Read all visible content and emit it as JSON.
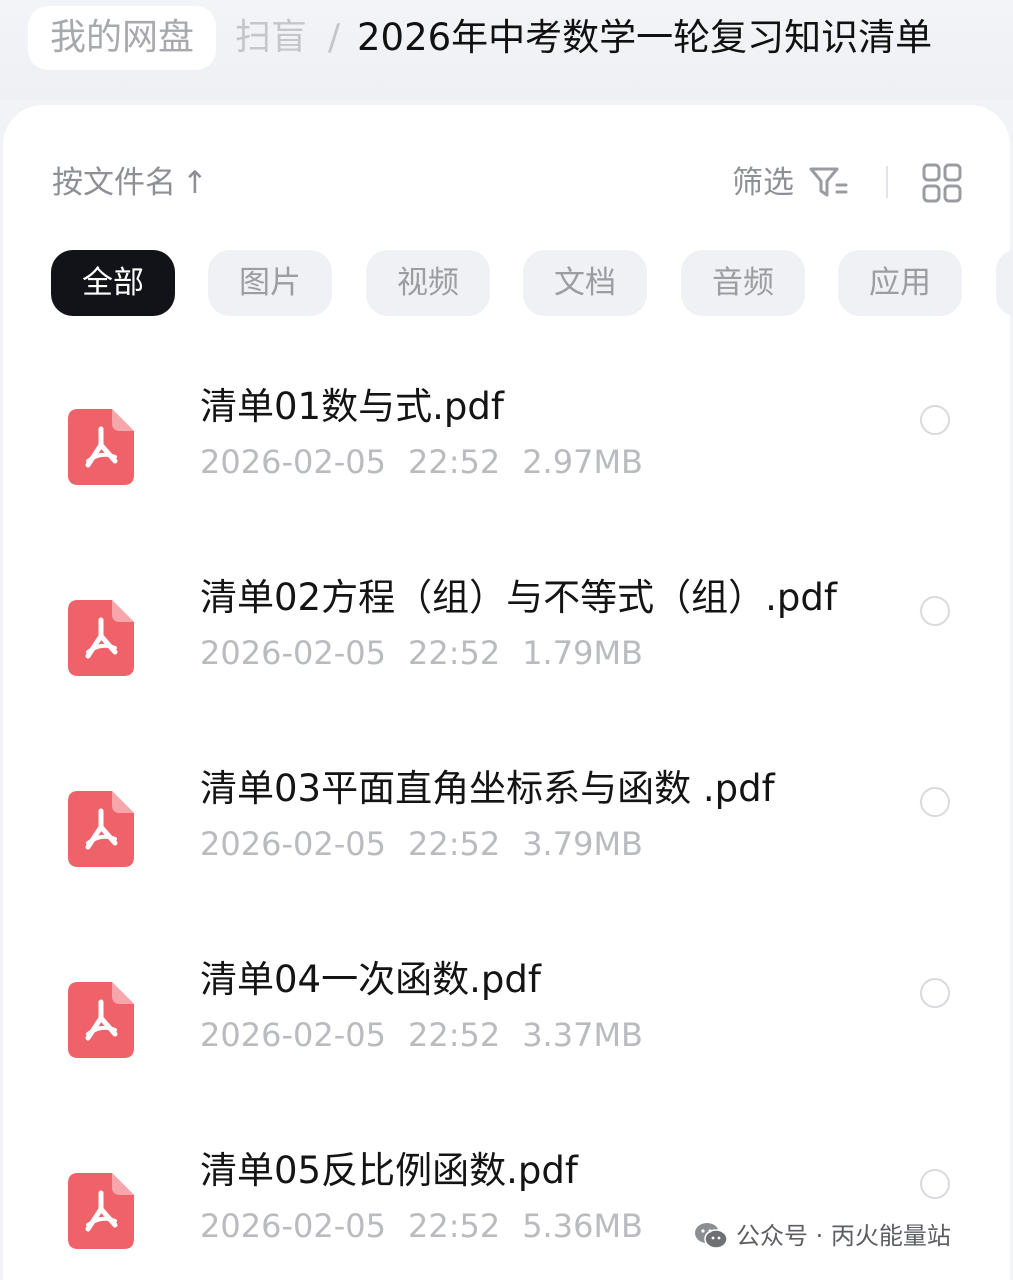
{
  "breadcrumb": {
    "home": "我的网盘",
    "parent": "扫盲",
    "separator": "/",
    "current": "2026年中考数学一轮复习知识清单"
  },
  "toolbar": {
    "sort_label": "按文件名",
    "sort_arrow": "↑",
    "filter_label": "筛选"
  },
  "categories": [
    {
      "label": "全部",
      "active": true
    },
    {
      "label": "图片",
      "active": false
    },
    {
      "label": "视频",
      "active": false
    },
    {
      "label": "文档",
      "active": false
    },
    {
      "label": "音频",
      "active": false
    },
    {
      "label": "应用",
      "active": false
    }
  ],
  "files": [
    {
      "name": "清单01数与式.pdf",
      "date": "2026-02-05",
      "time": "22:52",
      "size": "2.97MB",
      "icon": "pdf-icon"
    },
    {
      "name": "清单02方程（组）与不等式（组）.pdf",
      "date": "2026-02-05",
      "time": "22:52",
      "size": "1.79MB",
      "icon": "pdf-icon"
    },
    {
      "name": "清单03平面直角坐标系与函数 .pdf",
      "date": "2026-02-05",
      "time": "22:52",
      "size": "3.79MB",
      "icon": "pdf-icon"
    },
    {
      "name": "清单04一次函数.pdf",
      "date": "2026-02-05",
      "time": "22:52",
      "size": "3.37MB",
      "icon": "pdf-icon"
    },
    {
      "name": "清单05反比例函数.pdf",
      "date": "2026-02-05",
      "time": "22:52",
      "size": "5.36MB",
      "icon": "pdf-icon"
    }
  ],
  "watermark": "公众号 · 丙火能量站",
  "colors": {
    "pdf_red": "#f0626a",
    "active_chip": "#111318",
    "chip_bg": "#f0f1f4"
  }
}
